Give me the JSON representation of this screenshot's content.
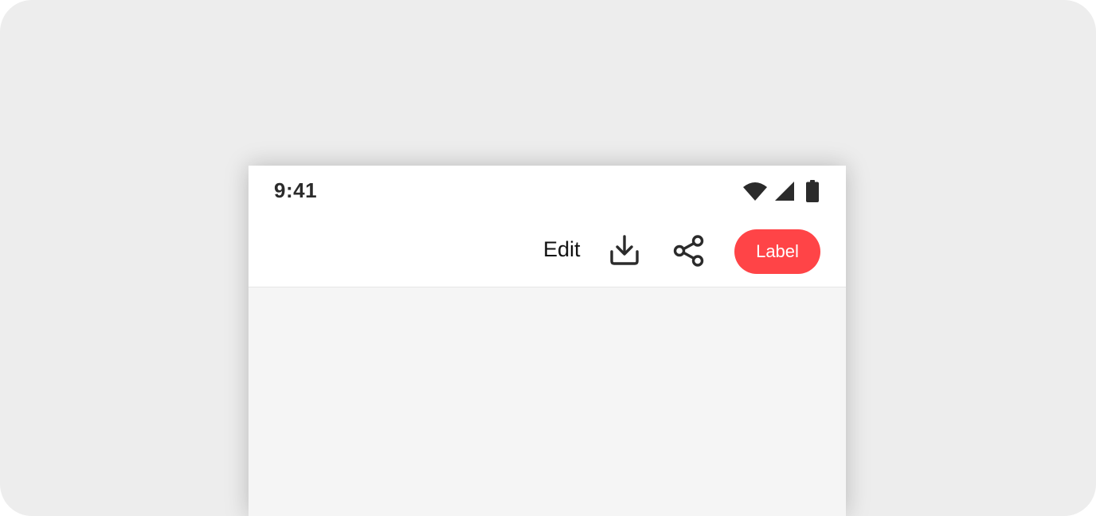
{
  "status_bar": {
    "time": "9:41",
    "icons": [
      "wifi-icon",
      "cellular-signal-icon",
      "battery-icon"
    ]
  },
  "app_bar": {
    "edit_label": "Edit",
    "download_icon": "download-icon",
    "share_icon": "share-icon",
    "primary_button_label": "Label"
  },
  "colors": {
    "primary_button": "#ff4447",
    "icon": "#2b2b2b",
    "background": "#ededed",
    "surface": "#ffffff",
    "content": "#f5f5f5"
  }
}
